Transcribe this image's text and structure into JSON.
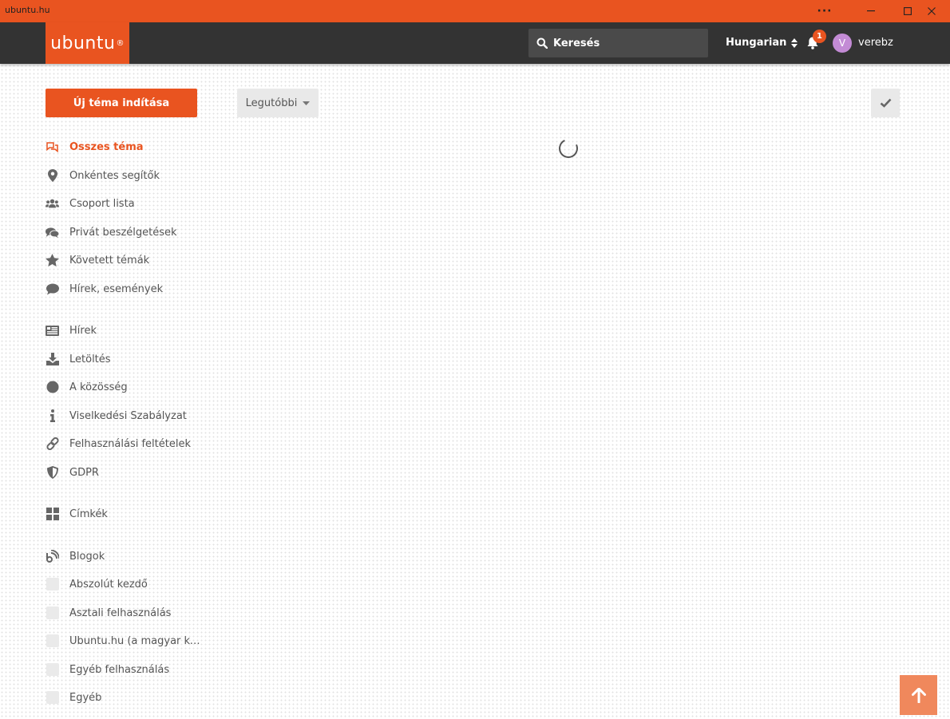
{
  "window": {
    "title": "ubuntu.hu"
  },
  "header": {
    "logo_text": "ubuntu",
    "search_placeholder": "Keresés",
    "language": "Hungarian",
    "notification_count": "1",
    "avatar_letter": "V",
    "username": "verebz"
  },
  "toolbar": {
    "new_topic_label": "Új téma indítása",
    "sort_label": "Legutóbbi"
  },
  "sidebar": {
    "main": [
      {
        "label": "Összes téma",
        "icon": "comments-icon"
      },
      {
        "label": "Önkéntes segítők",
        "icon": "map-marker-icon"
      },
      {
        "label": "Csoport lista",
        "icon": "users-icon"
      },
      {
        "label": "Privát beszélgetések",
        "icon": "private-chat-icon"
      },
      {
        "label": "Követett témák",
        "icon": "star-icon"
      },
      {
        "label": "Hírek, események",
        "icon": "comment-icon"
      }
    ],
    "links": [
      {
        "label": "Hírek",
        "icon": "newspaper-icon"
      },
      {
        "label": "Letöltés",
        "icon": "download-icon"
      },
      {
        "label": "A közösség",
        "icon": "circle-icon"
      },
      {
        "label": "Viselkedési Szabályzat",
        "icon": "info-icon"
      },
      {
        "label": "Felhasználási feltételek",
        "icon": "link-icon"
      },
      {
        "label": "GDPR",
        "icon": "shield-icon"
      }
    ],
    "tags": {
      "label": "Címkék",
      "icon": "tags-grid-icon"
    },
    "blogs": {
      "label": "Blogok",
      "icon": "blog-icon"
    },
    "categories": [
      {
        "label": "Abszolút kezdő"
      },
      {
        "label": "Asztali felhasználás"
      },
      {
        "label": "Ubuntu.hu (a magyar köz..."
      },
      {
        "label": "Egyéb felhasználás"
      },
      {
        "label": "Egyéb"
      }
    ]
  },
  "colors": {
    "accent": "#e95420",
    "header_bg": "#333333",
    "text": "#555555",
    "scroll_top": "#f0885c"
  }
}
